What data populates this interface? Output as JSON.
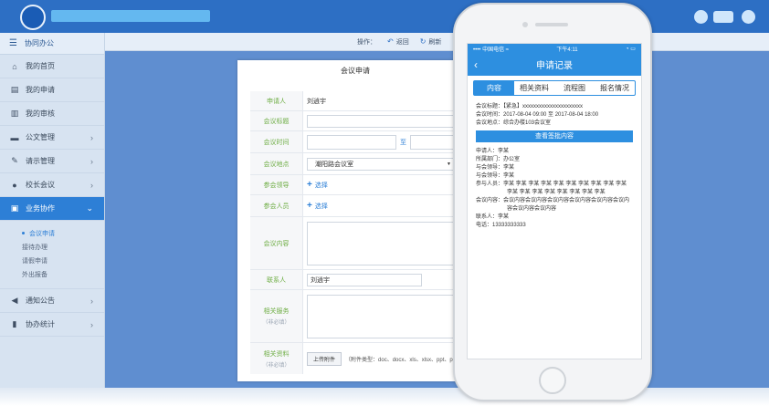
{
  "sidebar": {
    "header": "协同办公",
    "items": [
      {
        "label": "我的首页",
        "icon": "home-icon",
        "glyph": "⌂"
      },
      {
        "label": "我的申请",
        "icon": "document-icon",
        "glyph": "▤"
      },
      {
        "label": "我的审核",
        "icon": "book-icon",
        "glyph": "▥"
      },
      {
        "label": "公文管理",
        "icon": "folder-icon",
        "glyph": "▬"
      },
      {
        "label": "请示管理",
        "icon": "edit-icon",
        "glyph": "✎"
      },
      {
        "label": "校长会议",
        "icon": "user-icon",
        "glyph": "●"
      },
      {
        "label": "业务协作",
        "icon": "briefcase-icon",
        "glyph": "▣"
      },
      {
        "label": "通知公告",
        "icon": "speaker-icon",
        "glyph": "◀"
      },
      {
        "label": "协办统计",
        "icon": "chart-icon",
        "glyph": "▮"
      }
    ],
    "subitems": [
      "会议申请",
      "接待办理",
      "请假申请",
      "外出报备"
    ]
  },
  "toolbar": {
    "ops_label": "操作：",
    "back": "返回",
    "refresh": "刷新"
  },
  "form": {
    "title": "会议申请",
    "applicant_label": "申请人",
    "applicant_value": "刘逍宇",
    "topic_label": "会议标题",
    "time_label": "会议时间",
    "time_sep": "至",
    "place_label": "会议地点",
    "place_value": "潮阳路会议室",
    "leaders_label": "参会领导",
    "attendees_label": "参会人员",
    "select_label": "选择",
    "content_label": "会议内容",
    "contact_label": "联系人",
    "contact_value": "刘逍宇",
    "services_label": "相关服务",
    "services_sub": "（非必填）",
    "attach_label": "相关资料",
    "attach_sub": "（非必填）",
    "upload_label": "上传附件",
    "attach_hint": "（附件类型：doc、docx、xls、xlsx、ppt、pptx、jpg"
  },
  "phone": {
    "carrier": "•••• 中国电信 ≈",
    "time": "下午4:11",
    "battery": "◔ ▭",
    "title": "申请记录",
    "tabs": [
      "内容",
      "相关资料",
      "流程图",
      "报名情况"
    ],
    "meeting_topic": "会议标题：【紧急】xxxxxxxxxxxxxxxxxxxxxx",
    "meeting_time": "会议时间：2017-08-04 09:00   至   2017-08-04 18:00",
    "meeting_place": "会议地点：综合办楼103会议室",
    "view_button": "查看签批内容",
    "applicant": "申请人：李某",
    "dept": "所属部门：办公室",
    "leader1": "与会领导：李某",
    "leader2": "与会领导：李某",
    "attendees": "参与人员：李某 李某 李某 李某 李某 李某 李某 李某 李某 李某 李某 李某 李某 李某 李某 李某 李某 李某",
    "content": "会议内容：会议内容会议内容会议内容会议内容会议内容会议内容会议内容会议内容",
    "contact": "联系人：李某",
    "phone_num": "电话：13333333333"
  }
}
